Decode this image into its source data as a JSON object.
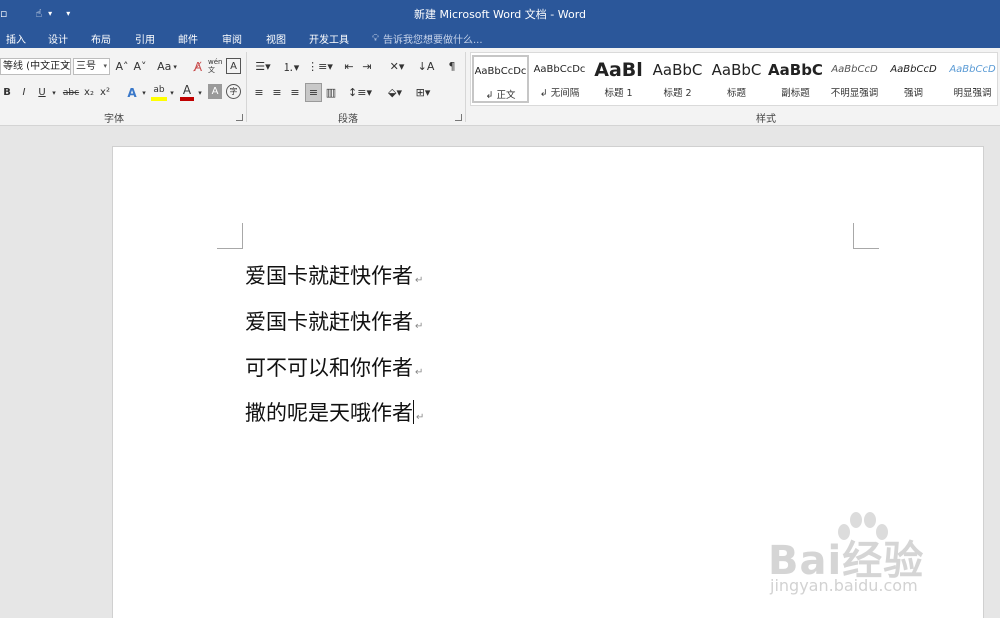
{
  "titlebar": {
    "title": "新建 Microsoft Word 文档 - Word"
  },
  "tabs": [
    {
      "label": "插入"
    },
    {
      "label": "设计"
    },
    {
      "label": "布局"
    },
    {
      "label": "引用"
    },
    {
      "label": "邮件"
    },
    {
      "label": "审阅"
    },
    {
      "label": "视图"
    },
    {
      "label": "开发工具"
    }
  ],
  "tellme": {
    "placeholder": "告诉我您想要做什么..."
  },
  "font": {
    "name": "等线 (中文正文",
    "size": "三号",
    "grow": "A˄",
    "shrink": "A˅",
    "case": "Aa",
    "bold": "B",
    "italic": "I",
    "underline": "U",
    "strike": "abc",
    "subscript": "x₂",
    "superscript": "x²",
    "phonetic": "wén 文",
    "group_label": "字体"
  },
  "paragraph": {
    "group_label": "段落"
  },
  "styles": {
    "group_label": "样式",
    "items": [
      {
        "sample": "AaBbCcDc",
        "name": "↲ 正文"
      },
      {
        "sample": "AaBbCcDc",
        "name": "↲ 无间隔"
      },
      {
        "sample": "AaBl",
        "name": "标题 1"
      },
      {
        "sample": "AaBbC",
        "name": "标题 2"
      },
      {
        "sample": "AaBbC",
        "name": "标题"
      },
      {
        "sample": "AaBbC",
        "name": "副标题"
      },
      {
        "sample": "AaBbCcD",
        "name": "不明显强调"
      },
      {
        "sample": "AaBbCcD",
        "name": "强调"
      },
      {
        "sample": "AaBbCcD",
        "name": "明显强调"
      }
    ]
  },
  "document": {
    "lines": [
      {
        "text": "爱国卡就赶快作者"
      },
      {
        "text": "爱国卡就赶快作者"
      },
      {
        "text": "可不可以和你作者"
      },
      {
        "text": "撒的呢是天哦作者"
      }
    ],
    "paragraph_mark": "↵"
  },
  "watermark": {
    "brand": "Bai经验",
    "url": "jingyan.baidu.com"
  },
  "colors": {
    "ribbon_blue": "#2b579a",
    "font_color_red": "#c00000",
    "highlight_yellow": "#ffff00"
  }
}
